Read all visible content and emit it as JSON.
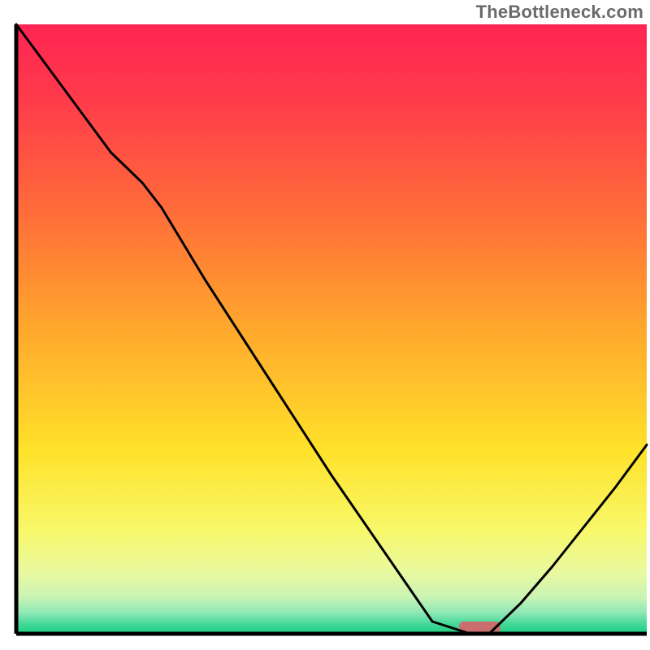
{
  "watermark": "TheBottleneck.com",
  "chart_data": {
    "type": "line",
    "title": "",
    "xlabel": "",
    "ylabel": "",
    "x": [
      0.0,
      0.05,
      0.1,
      0.15,
      0.2,
      0.23,
      0.3,
      0.4,
      0.5,
      0.6,
      0.66,
      0.72,
      0.75,
      0.8,
      0.85,
      0.9,
      0.95,
      1.0
    ],
    "values": [
      1.0,
      0.93,
      0.86,
      0.79,
      0.74,
      0.7,
      0.58,
      0.42,
      0.26,
      0.11,
      0.02,
      0.0,
      0.0,
      0.05,
      0.11,
      0.175,
      0.24,
      0.31
    ],
    "xlim": [
      0,
      1
    ],
    "ylim": [
      0,
      1
    ],
    "marker": {
      "x": 0.735,
      "width": 0.066,
      "color": "#c96d6d"
    },
    "gradient_stops": [
      {
        "offset": 0.0,
        "color": "#ff2452"
      },
      {
        "offset": 0.12,
        "color": "#ff3a4b"
      },
      {
        "offset": 0.3,
        "color": "#ff6a3a"
      },
      {
        "offset": 0.5,
        "color": "#ffa82c"
      },
      {
        "offset": 0.7,
        "color": "#ffe22a"
      },
      {
        "offset": 0.83,
        "color": "#f8f86a"
      },
      {
        "offset": 0.9,
        "color": "#e9f9a0"
      },
      {
        "offset": 0.94,
        "color": "#c9f4b4"
      },
      {
        "offset": 0.965,
        "color": "#90e8b6"
      },
      {
        "offset": 0.985,
        "color": "#3fd896"
      },
      {
        "offset": 1.0,
        "color": "#1ccf84"
      }
    ],
    "axis_color": "#000000",
    "line_color": "#000000",
    "line_width": 3
  }
}
